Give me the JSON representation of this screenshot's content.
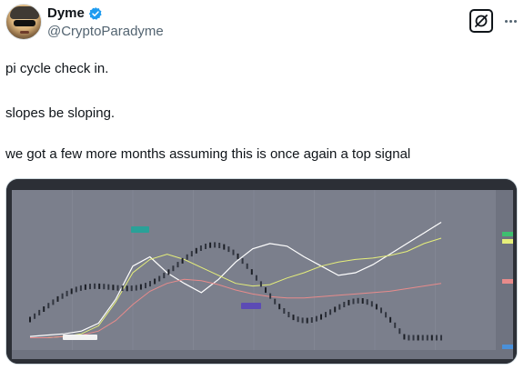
{
  "author": {
    "display_name": "Dyme",
    "handle": "@CryptoParadyme",
    "avatar_icon": "avatar-image",
    "verified_icon": "verified-badge-icon",
    "verified_color": "#1d9bf0"
  },
  "actions": {
    "grok_icon": "grok-icon",
    "more_icon": "more-options-icon"
  },
  "tweet": {
    "line1": "pi cycle check in.",
    "line2": "slopes be sloping.",
    "line3": "we got a few more months assuming this is once again a top signal"
  },
  "chart_data": {
    "type": "line",
    "series": [
      {
        "values": [
          2,
          3,
          4,
          6,
          12,
          30,
          55,
          62,
          50,
          42,
          35,
          45,
          58,
          68,
          72,
          70,
          62,
          55,
          48,
          50,
          56,
          64,
          72,
          80,
          88
        ],
        "color": "#ffffff"
      },
      {
        "values": [
          1,
          1,
          2,
          4,
          10,
          28,
          50,
          60,
          64,
          60,
          54,
          48,
          42,
          40,
          41,
          46,
          50,
          55,
          58,
          60,
          61,
          63,
          66,
          72,
          76
        ],
        "color": "#e6ef7a"
      },
      {
        "values": [
          1,
          1,
          2,
          3,
          6,
          14,
          26,
          36,
          42,
          45,
          44,
          41,
          37,
          34,
          32,
          31,
          31,
          32,
          33,
          34,
          35,
          36,
          38,
          40,
          42
        ],
        "color": "#e88b8b"
      }
    ],
    "colors": {
      "background": "#7b7f8c",
      "grid": "#8a8e9a"
    }
  }
}
